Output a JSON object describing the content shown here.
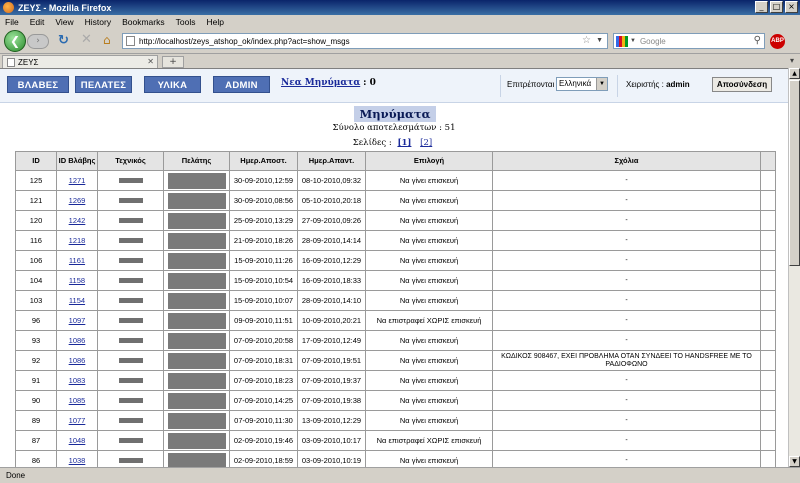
{
  "window": {
    "title": "ΖΕΥΣ - Mozilla Firefox",
    "minimize": "_",
    "maximize": "□",
    "close": "×"
  },
  "menu": [
    "File",
    "Edit",
    "View",
    "History",
    "Bookmarks",
    "Tools",
    "Help"
  ],
  "toolbar": {
    "back": "❮",
    "forward": "›",
    "reload": "↻",
    "stop": "✕",
    "home": "⌂",
    "url": "http://localhost/zeys_atshop_ok/index.php?act=show_msgs",
    "search_placeholder": "Google",
    "abp": "ABP"
  },
  "tabs": [
    {
      "label": "ΖΕΥΣ"
    }
  ],
  "tab_controls": {
    "new_tab": "+",
    "list": "▾"
  },
  "status": "Done",
  "app": {
    "nav": [
      "ΒΛΑΒΕΣ",
      "ΠΕΛΑΤΕΣ",
      "ΥΛΙΚΑ",
      "ADMIN"
    ],
    "new_messages_label": "Νεα Μηνύματα",
    "new_messages_count": ": 0",
    "language_label": "Επιτρέπονται :",
    "language_value": "Ελληνικά",
    "user_label": "Χειριστής :",
    "user_name": "admin",
    "logout": "Αποσύνδεση"
  },
  "page": {
    "title": "Μηνύματα",
    "total": "Σύνολο αποτελεσμάτων : 51",
    "pages_label": "Σελίδες :",
    "pages": [
      "1",
      "2"
    ],
    "current_page": "1"
  },
  "table": {
    "headers": [
      "ID",
      "ID Βλάβης",
      "Τεχνικός",
      "Πελάτης",
      "Ημερ.Αποστ.",
      "Ημερ.Απαντ.",
      "Επιλογή",
      "Σχόλια"
    ],
    "rows": [
      {
        "id": "125",
        "fault": "1271",
        "sent": "30-09-2010,12:59",
        "replied": "08-10-2010,09:32",
        "choice": "Να γίνει επισκευή",
        "comment": "-"
      },
      {
        "id": "121",
        "fault": "1269",
        "sent": "30-09-2010,08:56",
        "replied": "05-10-2010,20:18",
        "choice": "Να γίνει επισκευή",
        "comment": "-"
      },
      {
        "id": "120",
        "fault": "1242",
        "sent": "25-09-2010,13:29",
        "replied": "27-09-2010,09:26",
        "choice": "Να γίνει επισκευή",
        "comment": "-"
      },
      {
        "id": "116",
        "fault": "1218",
        "sent": "21-09-2010,18:26",
        "replied": "28-09-2010,14:14",
        "choice": "Να γίνει επισκευή",
        "comment": "-"
      },
      {
        "id": "106",
        "fault": "1161",
        "sent": "15-09-2010,11:26",
        "replied": "16-09-2010,12:29",
        "choice": "Να γίνει επισκευή",
        "comment": "-"
      },
      {
        "id": "104",
        "fault": "1158",
        "sent": "15-09-2010,10:54",
        "replied": "16-09-2010,18:33",
        "choice": "Να γίνει επισκευή",
        "comment": "-"
      },
      {
        "id": "103",
        "fault": "1154",
        "sent": "15-09-2010,10:07",
        "replied": "28-09-2010,14:10",
        "choice": "Να γίνει επισκευή",
        "comment": "-"
      },
      {
        "id": "96",
        "fault": "1097",
        "sent": "09-09-2010,11:51",
        "replied": "10-09-2010,20:21",
        "choice": "Να επιστραφεί ΧΩΡΙΣ επισκευή",
        "comment": "-"
      },
      {
        "id": "93",
        "fault": "1086",
        "sent": "07-09-2010,20:58",
        "replied": "17-09-2010,12:49",
        "choice": "Να γίνει επισκευή",
        "comment": "-"
      },
      {
        "id": "92",
        "fault": "1086",
        "sent": "07-09-2010,18:31",
        "replied": "07-09-2010,19:51",
        "choice": "Να γίνει επισκευή",
        "comment": "ΚΩΔΙΚΟΣ 908467, ΕΧΕΙ ΠΡΟΒΛΗΜΑ ΟΤΑΝ ΣΥΝΔΕΕΙ ΤΟ HANDSFREE ΜΕ ΤΟ ΡΑΔΙΟΦΩΝΟ"
      },
      {
        "id": "91",
        "fault": "1083",
        "sent": "07-09-2010,18:23",
        "replied": "07-09-2010,19:37",
        "choice": "Να γίνει επισκευή",
        "comment": "-"
      },
      {
        "id": "90",
        "fault": "1085",
        "sent": "07-09-2010,14:25",
        "replied": "07-09-2010,19:38",
        "choice": "Να γίνει επισκευή",
        "comment": "-"
      },
      {
        "id": "89",
        "fault": "1077",
        "sent": "07-09-2010,11:30",
        "replied": "13-09-2010,12:29",
        "choice": "Να γίνει επισκευή",
        "comment": "-"
      },
      {
        "id": "87",
        "fault": "1048",
        "sent": "02-09-2010,19:46",
        "replied": "03-09-2010,10:17",
        "choice": "Να επιστραφεί ΧΩΡΙΣ επισκευή",
        "comment": "-"
      },
      {
        "id": "86",
        "fault": "1038",
        "sent": "02-09-2010,18:59",
        "replied": "03-09-2010,10:19",
        "choice": "Να γίνει επισκευή",
        "comment": "-"
      }
    ]
  },
  "colors": {
    "nav_button": "#4f6fb4",
    "link": "#1a2a9a",
    "title_bg": "#c4cfe8",
    "header_bg": "#eef3fa"
  }
}
